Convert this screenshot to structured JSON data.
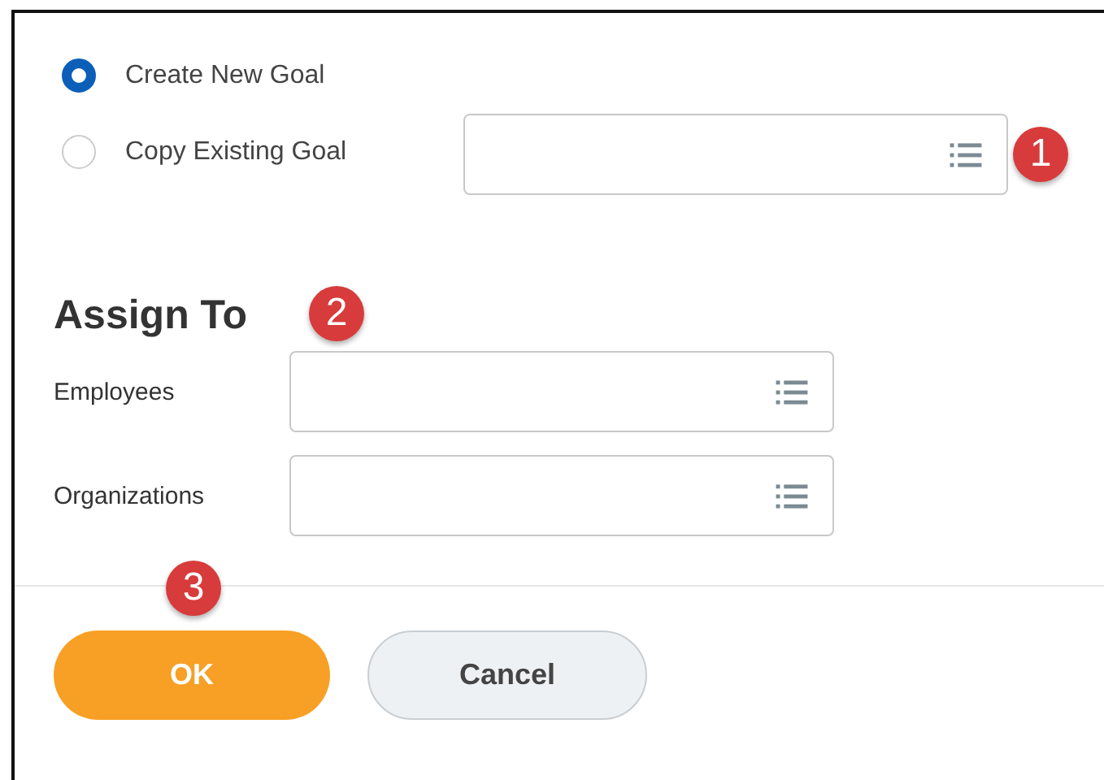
{
  "goal_options": [
    {
      "label": "Create New Goal",
      "selected": true
    },
    {
      "label": "Copy Existing Goal",
      "selected": false
    }
  ],
  "assign_to": {
    "heading": "Assign To",
    "fields": [
      {
        "label": "Employees"
      },
      {
        "label": "Organizations"
      }
    ]
  },
  "buttons": [
    {
      "label": "OK",
      "kind": "primary"
    },
    {
      "label": "Cancel",
      "kind": "secondary"
    }
  ],
  "callouts": [
    "1",
    "2",
    "3"
  ]
}
